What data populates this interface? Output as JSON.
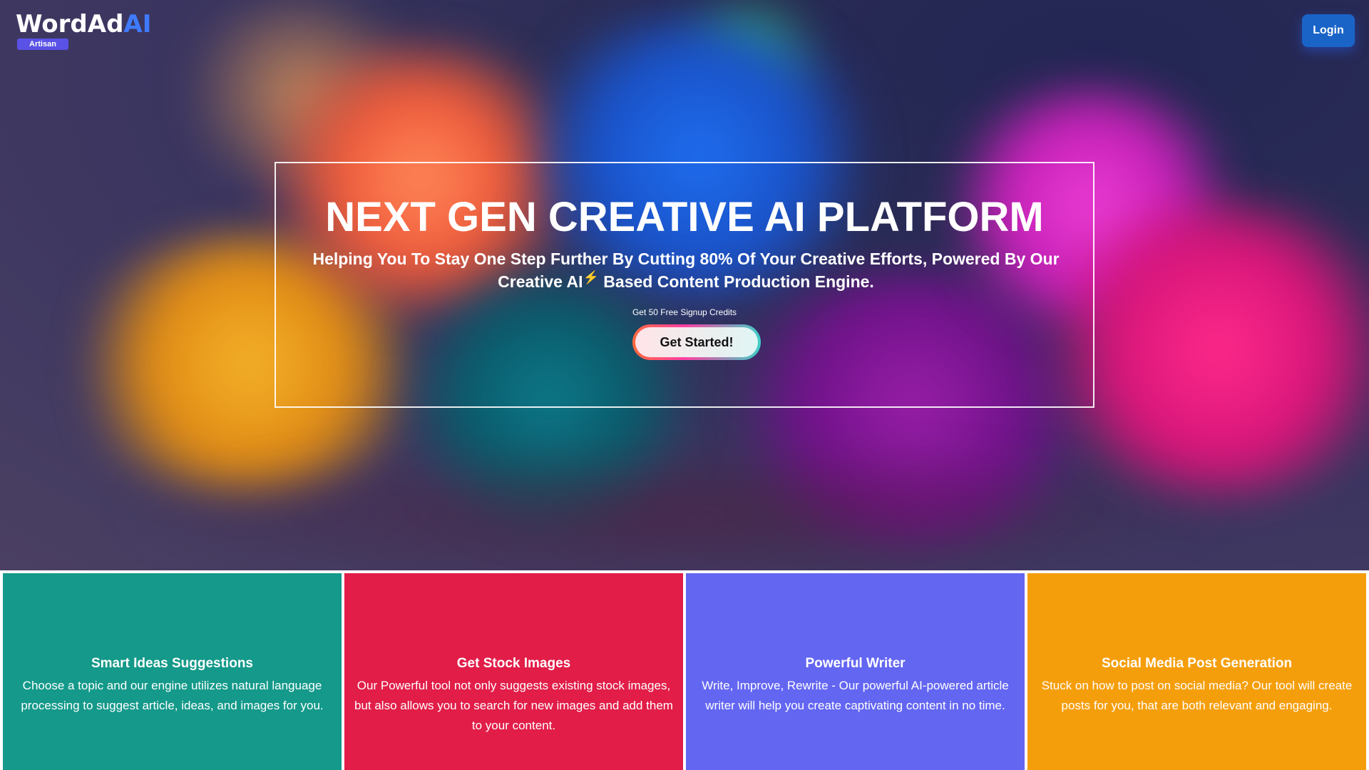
{
  "header": {
    "logo_main": "WordAd",
    "logo_accent": "AI",
    "badge": "Artisan",
    "login_label": "Login"
  },
  "hero": {
    "title": "NEXT GEN CREATIVE AI PLATFORM",
    "subtitle_before": "Helping You To Stay One Step Further By Cutting 80% Of Your Creative Efforts, Powered By Our Creative AI",
    "bolt": "⚡",
    "subtitle_after": " Based Content Production Engine.",
    "credits_note": "Get 50 Free Signup Credits",
    "cta_label": "Get Started!"
  },
  "features": [
    {
      "title": "Smart Ideas Suggestions",
      "text": "Choose a topic and our engine utilizes natural language processing to suggest article, ideas, and images for you.",
      "color": "#14998a"
    },
    {
      "title": "Get Stock Images",
      "text": "Our Powerful tool not only suggests existing stock images, but also allows you to search for new images and add them to your content.",
      "color": "#e11d48"
    },
    {
      "title": "Powerful Writer",
      "text": "Write, Improve, Rewrite - Our powerful AI-powered article writer will help you create captivating content in no time.",
      "color": "#6366f1"
    },
    {
      "title": "Social Media Post Generation",
      "text": "Stuck on how to post on social media? Our tool will create posts for you, that are both relevant and engaging.",
      "color": "#f59e0b"
    }
  ]
}
